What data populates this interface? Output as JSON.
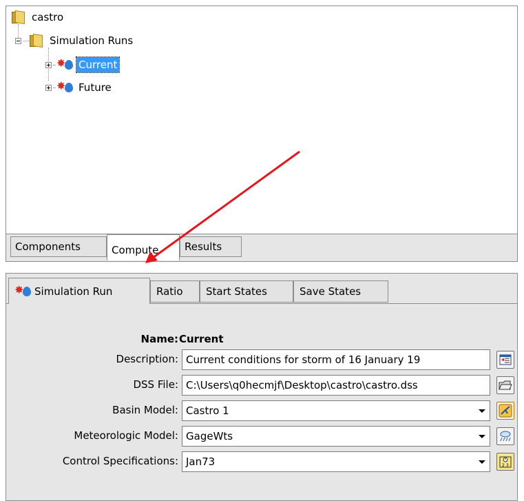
{
  "tree": {
    "root": "castro",
    "folder": "Simulation Runs",
    "runs": [
      {
        "label": "Current",
        "selected": true
      },
      {
        "label": "Future",
        "selected": false
      }
    ]
  },
  "upper_tabs": [
    "Components",
    "Compute",
    "Results"
  ],
  "upper_active": "Compute",
  "lower_tabs": [
    "Simulation Run",
    "Ratio",
    "Start States",
    "Save States"
  ],
  "form": {
    "name_label": "Name:",
    "name_value": "Current",
    "description_label": "Description:",
    "description_value": "Current conditions for storm of 16 January 19",
    "dss_label": "DSS File:",
    "dss_value": "C:\\Users\\q0hecmjf\\Desktop\\castro\\castro.dss",
    "basin_label": "Basin Model:",
    "basin_value": "Castro 1",
    "met_label": "Meteorologic Model:",
    "met_value": "GageWts",
    "control_label": "Control Specifications:",
    "control_value": "Jan73"
  },
  "icons": {
    "description_button": "description-editor-icon",
    "dss_button": "open-folder-icon",
    "basin_button": "basin-model-icon",
    "met_button": "meteorologic-model-icon",
    "control_button": "calendar-icon"
  },
  "colors": {
    "selection": "#3399ff",
    "arrow": "#e8141b",
    "run_icon_burst": "#e0291b",
    "run_icon_drop": "#2f7fd8"
  }
}
